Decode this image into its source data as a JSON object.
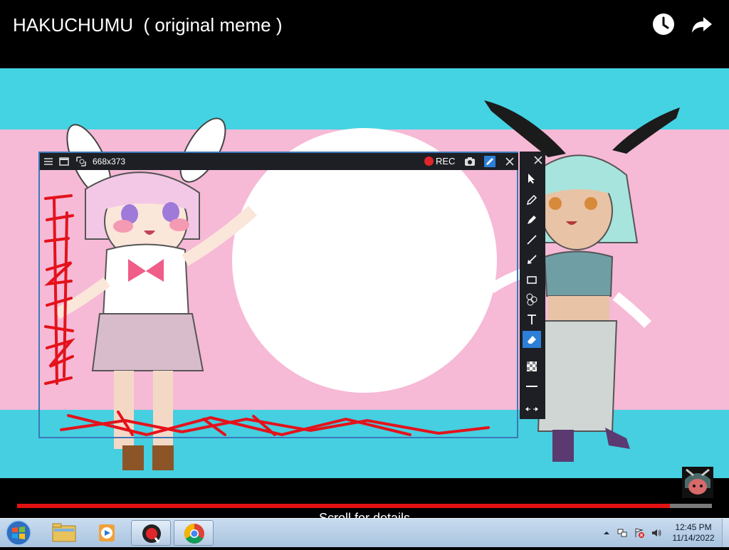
{
  "video": {
    "title": "HAKUCHUMU  ( original meme )",
    "progress_fraction": 0.94,
    "scroll_hint": "Scroll for details"
  },
  "recorder": {
    "size_label": "668x373",
    "rec_label": "REC",
    "tools": [
      "pointer-icon",
      "pencil-icon",
      "marker-icon",
      "line-icon",
      "arrow-icon",
      "rectangle-icon",
      "numbering-icon",
      "text-icon",
      "eraser-icon",
      "blur-icon",
      "line-width-icon",
      "toggle-panel-icon"
    ],
    "active_tool": "eraser-icon"
  },
  "taskbar": {
    "apps": [
      "start-button",
      "file-explorer",
      "media-player",
      "recorder-app",
      "chrome"
    ],
    "time": "12:45 PM",
    "date": "11/14/2022"
  },
  "colors": {
    "accent_red": "#e21212",
    "sky": "#45d4e4",
    "pink": "#f6b7d5",
    "panel": "#1d1f24",
    "select_blue": "#2b7fd6"
  }
}
